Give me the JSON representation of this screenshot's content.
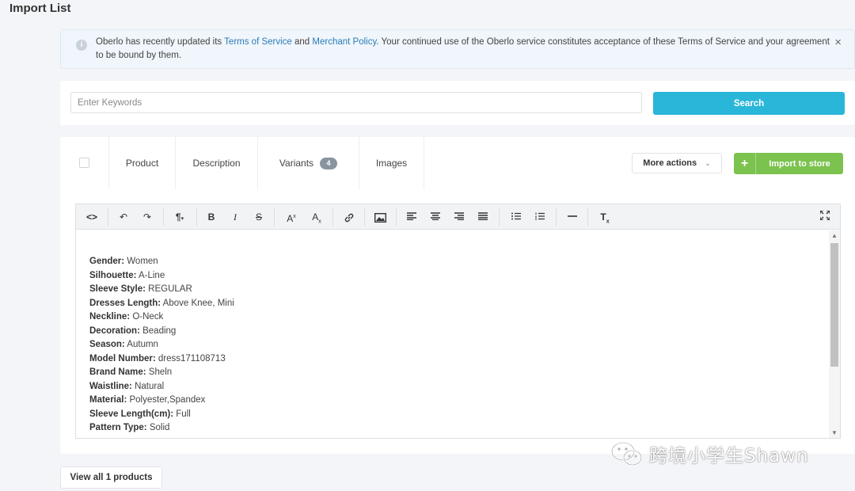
{
  "page": {
    "title": "Import List"
  },
  "notice": {
    "text_before": "Oberlo has recently updated its ",
    "link1": "Terms of Service",
    "text_mid": " and ",
    "link2": "Merchant Policy",
    "text_after": ". Your continued use of the Oberlo service constitutes acceptance of these Terms of Service and your agreement to be bound by them.",
    "close_label": "×"
  },
  "search": {
    "placeholder": "Enter Keywords",
    "value": "",
    "button_label": "Search"
  },
  "tabs": [
    {
      "label": "Product"
    },
    {
      "label": "Description"
    },
    {
      "label": "Variants",
      "badge": "4"
    },
    {
      "label": "Images"
    }
  ],
  "actions": {
    "more_label": "More actions",
    "import_label": "Import to store",
    "import_plus": "+"
  },
  "toolbar": {
    "icons": [
      "code-view-icon",
      "undo-icon",
      "redo-icon",
      "paragraph-format-icon",
      "bold-icon",
      "italic-icon",
      "strikethrough-icon",
      "superscript-icon",
      "subscript-icon",
      "link-icon",
      "image-icon",
      "align-left-icon",
      "align-center-icon",
      "align-right-icon",
      "align-justify-icon",
      "bullet-list-icon",
      "numbered-list-icon",
      "horizontal-line-icon",
      "clear-format-icon",
      "fullscreen-icon"
    ]
  },
  "description": {
    "rows": [
      {
        "label": "Gender:",
        "value": " Women"
      },
      {
        "label": "Silhouette:",
        "value": " A-Line"
      },
      {
        "label": "Sleeve Style:",
        "value": " REGULAR"
      },
      {
        "label": "Dresses Length:",
        "value": " Above Knee, Mini"
      },
      {
        "label": "Neckline:",
        "value": " O-Neck"
      },
      {
        "label": "Decoration:",
        "value": " Beading"
      },
      {
        "label": "Season:",
        "value": " Autumn"
      },
      {
        "label": "Model Number:",
        "value": " dress171108713"
      },
      {
        "label": "Brand Name:",
        "value": " Sheln"
      },
      {
        "label": "Waistline:",
        "value": " Natural"
      },
      {
        "label": "Material:",
        "value": " Polyester,Spandex"
      },
      {
        "label": "Sleeve Length(cm):",
        "value": " Full"
      },
      {
        "label": "Pattern Type:",
        "value": " Solid"
      }
    ]
  },
  "footer": {
    "view_all_label": "View all 1 products"
  },
  "watermark": {
    "text": "跨境小学生Shawn"
  },
  "colors": {
    "search_button": "#29b6d8",
    "import_button": "#7cc24e",
    "link": "#2b7bb9"
  }
}
